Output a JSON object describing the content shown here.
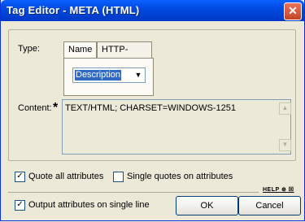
{
  "window": {
    "title": "Tag Editor - META   (HTML)",
    "close_glyph": "✕"
  },
  "type_section": {
    "label": "Type:",
    "tabs": [
      {
        "label": "Name"
      },
      {
        "label": "HTTP-Equiv"
      }
    ],
    "select": {
      "value": "Description",
      "arrow": "▼"
    }
  },
  "content_section": {
    "label": "Content:",
    "required_marker": "*",
    "value": "TEXT/HTML; CHARSET=WINDOWS-1251"
  },
  "options": {
    "quote_all": {
      "label": "Quote all attributes",
      "checked": true
    },
    "single_quotes": {
      "label": "Single quotes on attributes",
      "checked": false
    },
    "single_line": {
      "label": "Output attributes on single line",
      "checked": true
    }
  },
  "help": {
    "label": "HELP ⊕ ☒"
  },
  "buttons": {
    "ok": "OK",
    "cancel": "Cancel"
  }
}
